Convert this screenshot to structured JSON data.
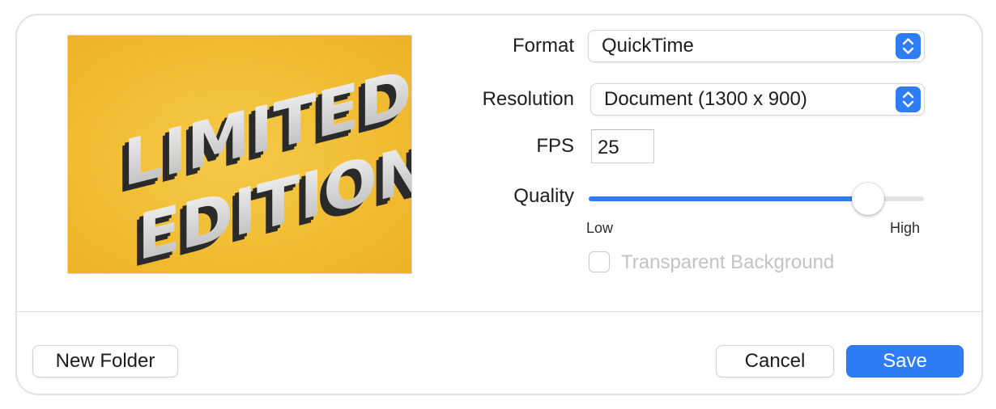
{
  "preview": {
    "image_text": "LIMITED EDITION",
    "background_color": "#f2c037"
  },
  "format": {
    "label": "Format",
    "value": "QuickTime"
  },
  "resolution": {
    "label": "Resolution",
    "value": "Document (1300 x 900)"
  },
  "fps": {
    "label": "FPS",
    "value": "25"
  },
  "quality": {
    "label": "Quality",
    "level": 0.87,
    "low_label": "Low",
    "high_label": "High"
  },
  "transparent_background": {
    "label": "Transparent Background",
    "checked": false,
    "enabled": false
  },
  "buttons": {
    "new_folder": "New Folder",
    "cancel": "Cancel",
    "save": "Save"
  },
  "colors": {
    "accent": "#2f7df6",
    "disabled_text": "#c3c3c3"
  },
  "icons": {
    "popup_stepper": "chevron-up-down-icon"
  }
}
